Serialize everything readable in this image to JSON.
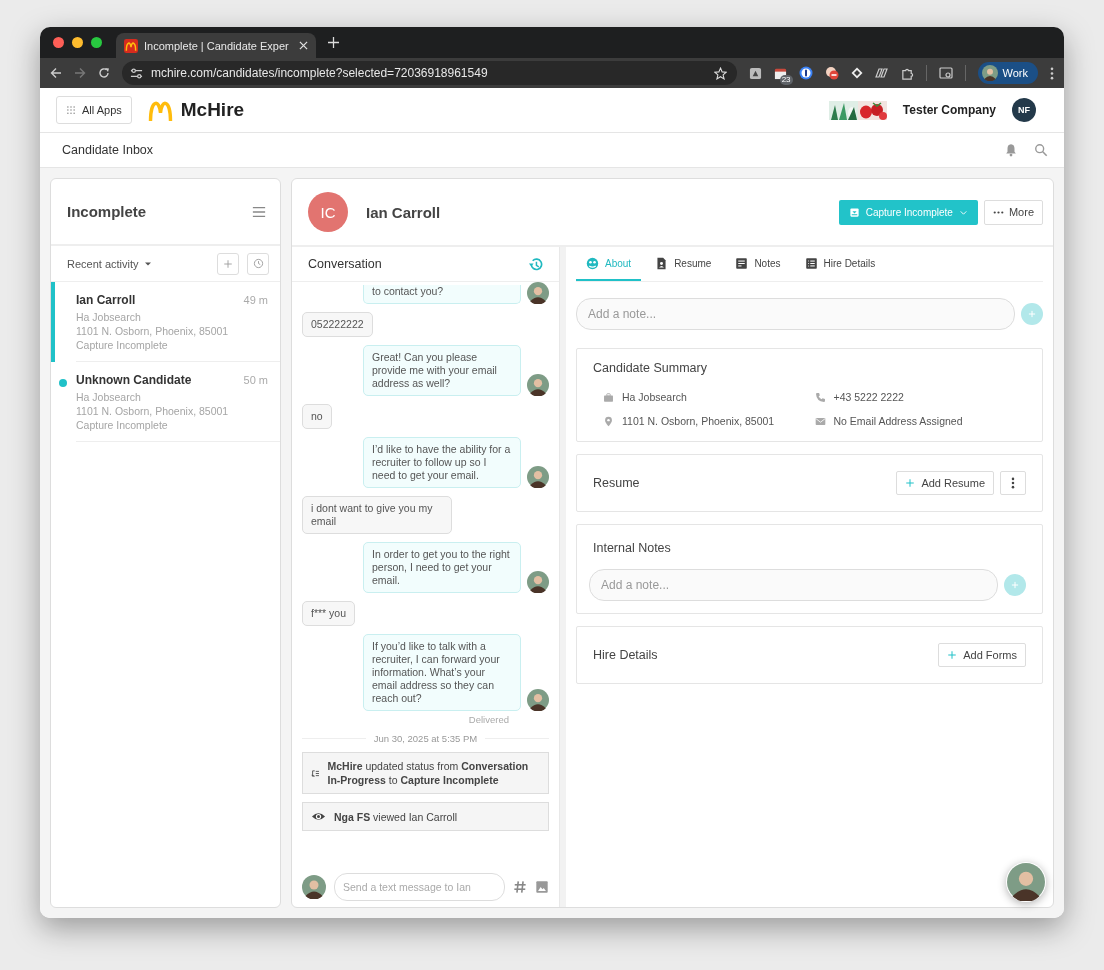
{
  "browser": {
    "tab_title": "Incomplete | Candidate Exper",
    "url": "mchire.com/candidates/incomplete?selected=72036918961549",
    "calendar_badge": "23",
    "profile": "Work"
  },
  "header": {
    "apps_button": "All Apps",
    "brand": "McHire",
    "company": "Tester Company",
    "user_initials": "NF"
  },
  "subheader": {
    "title": "Candidate Inbox"
  },
  "inbox": {
    "title": "Incomplete",
    "sort": "Recent activity",
    "items": [
      {
        "name": "Ian Carroll",
        "time": "49 m",
        "source": "Ha Jobsearch",
        "address": "1101 N. Osborn, Phoenix, 85001",
        "status": "Capture Incomplete",
        "selected": true,
        "unread": false
      },
      {
        "name": "Unknown Candidate",
        "time": "50 m",
        "source": "Ha Jobsearch",
        "address": "1101 N. Osborn, Phoenix, 85001",
        "status": "Capture Incomplete",
        "selected": false,
        "unread": true
      }
    ]
  },
  "candidate": {
    "initials": "IC",
    "name": "Ian Carroll",
    "status_button": "Capture Incomplete",
    "more_button": "More"
  },
  "conversation": {
    "title": "Conversation",
    "messages": [
      {
        "kind": "agent",
        "text": "to contact you?"
      },
      {
        "kind": "candidate",
        "text": "052222222"
      },
      {
        "kind": "agent",
        "text": "Great! Can you please provide me with your email address as well?"
      },
      {
        "kind": "candidate",
        "text": "no"
      },
      {
        "kind": "agent",
        "text": "I’d like to have the ability for a recruiter to follow up so I need to get your email."
      },
      {
        "kind": "candidate",
        "text": "i dont want to give you my email"
      },
      {
        "kind": "agent",
        "text": "In order to get you to the right person, I need to get your email."
      },
      {
        "kind": "candidate",
        "text": "f*** you"
      },
      {
        "kind": "agent",
        "text": "If you’d like to talk with a recruiter, I can forward your information. What’s your email address so they can reach out?"
      }
    ],
    "delivered": "Delivered",
    "date": "Jun 30, 2025 at 5:35 PM",
    "events": [
      {
        "kind": "status",
        "text": "**McHire** updated status from **Conversation In-Progress** to **Capture Incomplete**"
      },
      {
        "kind": "view",
        "text": "**Nga FS** viewed Ian Carroll"
      }
    ],
    "composer_placeholder": "Send a text message to Ian"
  },
  "details": {
    "tabs": [
      {
        "kind": "about",
        "label": "About",
        "selected": true
      },
      {
        "kind": "resume",
        "label": "Resume",
        "selected": false
      },
      {
        "kind": "notes",
        "label": "Notes",
        "selected": false
      },
      {
        "kind": "hire",
        "label": "Hire Details",
        "selected": false
      }
    ],
    "note_placeholder": "Add a note...",
    "summary": {
      "title": "Candidate Summary",
      "fields": [
        {
          "kind": "source",
          "text": "Ha Jobsearch"
        },
        {
          "kind": "phone",
          "text": "+43 5222 2222"
        },
        {
          "kind": "address",
          "text": "1101 N. Osborn, Phoenix, 85001"
        },
        {
          "kind": "email",
          "text": "No Email Address Assigned"
        }
      ]
    },
    "resume": {
      "title": "Resume",
      "button": "Add Resume"
    },
    "internal_notes": {
      "title": "Internal Notes",
      "placeholder": "Add a note..."
    },
    "hire_details": {
      "title": "Hire Details",
      "button": "Add Forms"
    }
  }
}
